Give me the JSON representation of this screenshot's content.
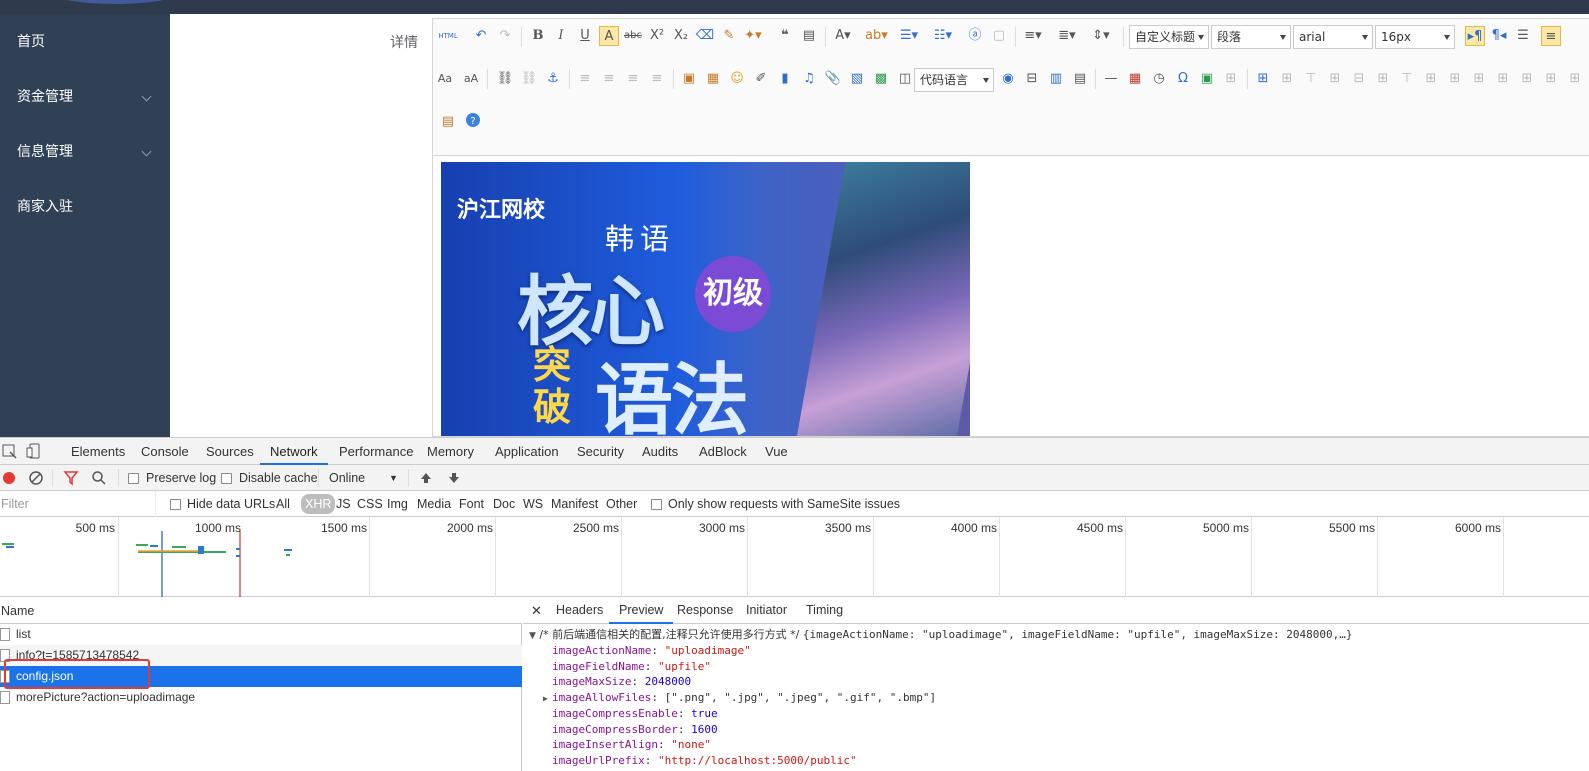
{
  "sidebar": {
    "items": [
      {
        "label": "首页",
        "has_arrow": false
      },
      {
        "label": "资金管理",
        "has_arrow": true
      },
      {
        "label": "信息管理",
        "has_arrow": true
      },
      {
        "label": "商家入驻",
        "has_arrow": false
      }
    ]
  },
  "form": {
    "detail_label": "详情"
  },
  "editor": {
    "toolbar_row1": [
      "html-source-icon",
      "undo-icon",
      "redo-icon",
      "bold-icon",
      "italic-icon",
      "underline-icon",
      "font-border-icon",
      "strikethrough-icon",
      "superscript-icon",
      "subscript-icon",
      "eraser-icon",
      "format-brush-icon",
      "auto-typeset-icon",
      "blockquote-icon",
      "paste-plain-icon",
      "forecolor-icon",
      "backcolor-icon",
      "ordered-list-icon",
      "unordered-list-icon",
      "select-all-icon",
      "clear-doc-icon",
      "row-spacing-top-icon",
      "row-spacing-bottom-icon",
      "line-height-icon"
    ],
    "custom_title": "自定义标题",
    "paragraph": "段落",
    "font_family": "arial",
    "font_size": "16px",
    "code_language": "代码语言",
    "banner": {
      "logo": "沪江网校",
      "line1": "韩语",
      "line2": "核心",
      "badge": "初级",
      "line3a": "突破",
      "line3b": "语法"
    }
  },
  "devtools": {
    "tabs": [
      "Elements",
      "Console",
      "Sources",
      "Network",
      "Performance",
      "Memory",
      "Application",
      "Security",
      "Audits",
      "AdBlock",
      "Vue"
    ],
    "active_tab": "Network",
    "toolbar": {
      "preserve_log": "Preserve log",
      "disable_cache": "Disable cache",
      "throttle": "Online"
    },
    "filter": {
      "placeholder": "Filter",
      "hide_data_urls": "Hide data URLs",
      "types": [
        "All",
        "XHR",
        "JS",
        "CSS",
        "Img",
        "Media",
        "Font",
        "Doc",
        "WS",
        "Manifest",
        "Other"
      ],
      "active_type": "XHR",
      "samesite": "Only show requests with SameSite issues"
    },
    "timeline_ticks": [
      "500 ms",
      "1000 ms",
      "1500 ms",
      "2000 ms",
      "2500 ms",
      "3000 ms",
      "3500 ms",
      "4000 ms",
      "4500 ms",
      "5000 ms",
      "5500 ms",
      "6000 ms"
    ],
    "requests_header": "Name",
    "requests": [
      "list",
      "info?t=1585713478542",
      "config.json",
      "morePicture?action=uploadimage"
    ],
    "selected_request": "config.json",
    "detail_tabs": [
      "Headers",
      "Preview",
      "Response",
      "Initiator",
      "Timing"
    ],
    "active_detail_tab": "Preview",
    "preview": {
      "summary_comment": "/* 前后端通信相关的配置,注释只允许使用多行方式 */",
      "summary_obj": "{imageActionName: \"uploadimage\", imageFieldName: \"upfile\", imageMaxSize: 2048000,…}",
      "props": [
        {
          "key": "imageActionName",
          "value": "\"uploadimage\"",
          "type": "s",
          "expandable": false
        },
        {
          "key": "imageFieldName",
          "value": "\"upfile\"",
          "type": "s",
          "expandable": false
        },
        {
          "key": "imageMaxSize",
          "value": "2048000",
          "type": "n",
          "expandable": false
        },
        {
          "key": "imageAllowFiles",
          "value": "[\".png\", \".jpg\", \".jpeg\", \".gif\", \".bmp\"]",
          "type": "a",
          "expandable": true
        },
        {
          "key": "imageCompressEnable",
          "value": "true",
          "type": "n",
          "expandable": false
        },
        {
          "key": "imageCompressBorder",
          "value": "1600",
          "type": "n",
          "expandable": false
        },
        {
          "key": "imageInsertAlign",
          "value": "\"none\"",
          "type": "s",
          "expandable": false
        },
        {
          "key": "imageUrlPrefix",
          "value": "\"http://localhost:5000/public\"",
          "type": "s",
          "expandable": false
        }
      ]
    }
  }
}
